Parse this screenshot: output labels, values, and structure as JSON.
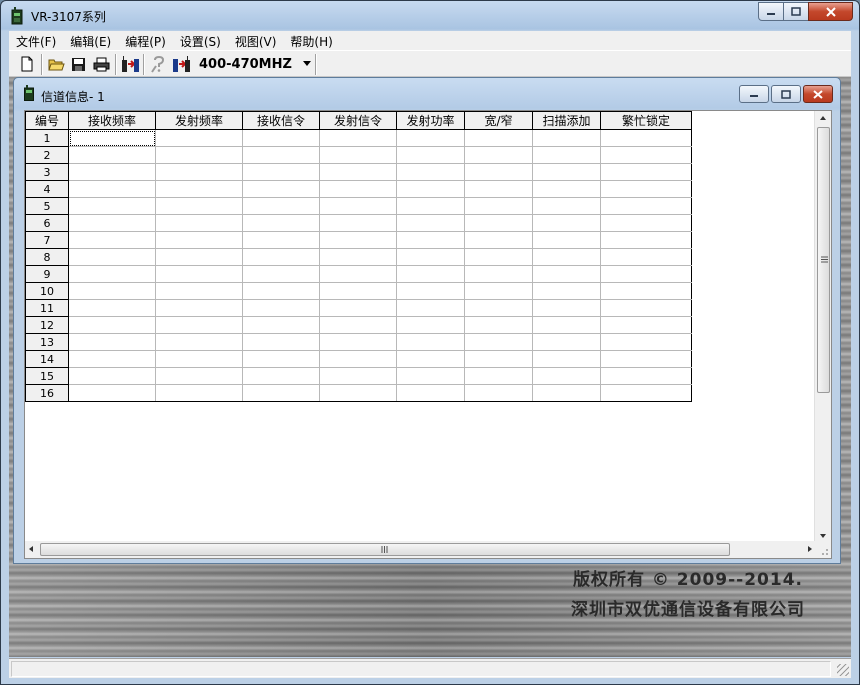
{
  "app": {
    "title": "VR-3107系列",
    "icon": "radio-icon"
  },
  "menu": [
    {
      "label": "文件(F)"
    },
    {
      "label": "编辑(E)"
    },
    {
      "label": "编程(P)"
    },
    {
      "label": "设置(S)"
    },
    {
      "label": "视图(V)"
    },
    {
      "label": "帮助(H)"
    }
  ],
  "toolbar": {
    "buttons": [
      "new-file-icon",
      "open-folder-icon",
      "save-icon",
      "print-icon",
      "read-radio-icon",
      "help-icon",
      "write-radio-icon"
    ],
    "band": {
      "selected": "400-470MHZ"
    }
  },
  "child_window": {
    "title": "信道信息- 1"
  },
  "table": {
    "columns": [
      "编号",
      "接收频率",
      "发射频率",
      "接收信令",
      "发射信令",
      "发射功率",
      "宽/窄",
      "扫描添加",
      "繁忙锁定"
    ],
    "rows": [
      "1",
      "2",
      "3",
      "4",
      "5",
      "6",
      "7",
      "8",
      "9",
      "10",
      "11",
      "12",
      "13",
      "14",
      "15",
      "16"
    ]
  },
  "copyright": {
    "line1": "版权所有 © 2009--2014.",
    "line2": "深圳市双优通信设备有限公司"
  },
  "colors": {
    "accent": "#b3cbe6",
    "close": "#c4482c"
  }
}
